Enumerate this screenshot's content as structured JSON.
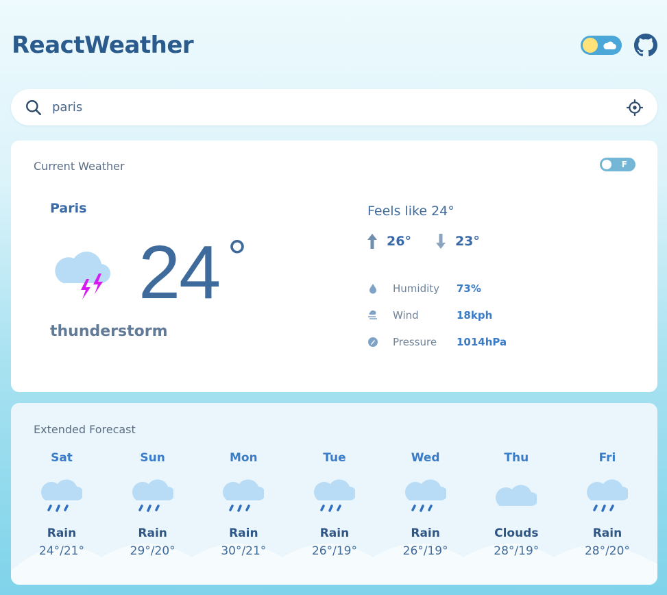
{
  "app": {
    "title": "ReactWeather"
  },
  "search": {
    "value": "paris"
  },
  "current": {
    "section_title": "Current Weather",
    "unit_toggle_label": "F",
    "city": "Paris",
    "temperature": "24",
    "temperature_degree": "°",
    "condition": "thunderstorm",
    "feels_like": "Feels like 24°",
    "max_temp": "26°",
    "min_temp": "23°",
    "details": [
      {
        "label": "Humidity",
        "value": "73%",
        "icon": "droplet-icon"
      },
      {
        "label": "Wind",
        "value": "18kph",
        "icon": "wind-icon"
      },
      {
        "label": "Pressure",
        "value": "1014hPa",
        "icon": "gauge-icon"
      }
    ]
  },
  "forecast": {
    "section_title": "Extended Forecast",
    "days": [
      {
        "day": "Sat",
        "condition": "Rain",
        "temps": "24°/21°",
        "icon": "rain-cloud-icon"
      },
      {
        "day": "Sun",
        "condition": "Rain",
        "temps": "29°/20°",
        "icon": "rain-cloud-icon"
      },
      {
        "day": "Mon",
        "condition": "Rain",
        "temps": "30°/21°",
        "icon": "rain-cloud-icon"
      },
      {
        "day": "Tue",
        "condition": "Rain",
        "temps": "26°/19°",
        "icon": "rain-cloud-icon"
      },
      {
        "day": "Wed",
        "condition": "Rain",
        "temps": "26°/19°",
        "icon": "rain-cloud-icon"
      },
      {
        "day": "Thu",
        "condition": "Clouds",
        "temps": "28°/19°",
        "icon": "cloud-icon"
      },
      {
        "day": "Fri",
        "condition": "Rain",
        "temps": "28°/20°",
        "icon": "rain-cloud-icon"
      }
    ]
  },
  "colors": {
    "accent": "#3a7cc8",
    "title": "#2b5a8c",
    "lightning": "#d61bf0",
    "cloud": "#b9dcf6"
  }
}
